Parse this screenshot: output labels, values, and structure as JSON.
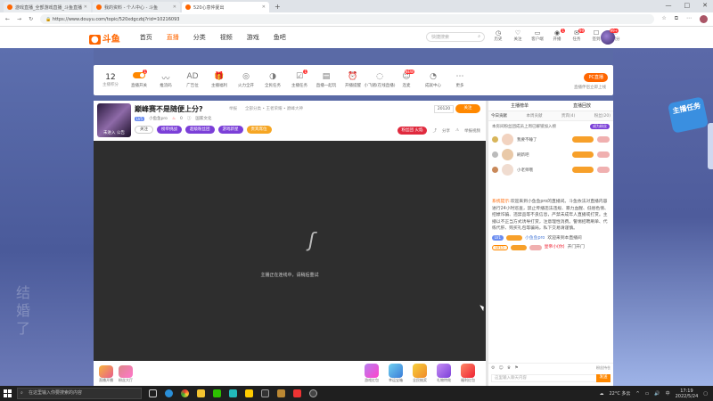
{
  "browser": {
    "tabs": [
      {
        "title": "游戏直播_全部游戏直播_斗鱼直播",
        "active": false
      },
      {
        "title": "我的资料 - 个人中心 - 斗鱼",
        "active": false
      },
      {
        "title": "520心意仲夏出",
        "active": true
      }
    ],
    "new_tab": "+",
    "window_controls": [
      "—",
      "□",
      "✕"
    ],
    "url": "https://www.douyu.com/topic/520xdgczbj?rid=10216093"
  },
  "site": {
    "logo_text": "斗鱼",
    "nav": [
      "首页",
      "直播",
      "分类",
      "视频",
      "游戏",
      "鱼吧"
    ],
    "active_nav": "直播",
    "search_placeholder": "快捷搜索",
    "header_icons": [
      {
        "label": "历史",
        "glyph": "◷",
        "badge": ""
      },
      {
        "label": "关注",
        "glyph": "♡",
        "badge": ""
      },
      {
        "label": "客户端",
        "glyph": "▭",
        "badge": ""
      },
      {
        "label": "开播",
        "glyph": "◉",
        "badge": "1"
      },
      {
        "label": "任务",
        "glyph": "✉",
        "badge": "99"
      },
      {
        "label": "签到",
        "glyph": "☐",
        "badge": ""
      },
      {
        "label": "积分",
        "glyph": "♡",
        "badge": ""
      }
    ],
    "user_badge": "99+"
  },
  "toolbar": {
    "stat_value": "12",
    "stat_label": "主播积分",
    "items": [
      {
        "label": "直播开关",
        "glyph": "⏻",
        "badge": "1"
      },
      {
        "label": "推流码",
        "glyph": "〰",
        "badge": ""
      },
      {
        "label": "广告位",
        "glyph": "AD",
        "badge": ""
      },
      {
        "label": "主播福利",
        "glyph": "🎁",
        "badge": ""
      },
      {
        "label": "火力全开",
        "glyph": "◎",
        "badge": ""
      },
      {
        "label": "全民任务",
        "glyph": "◑",
        "badge": ""
      },
      {
        "label": "主播任务",
        "glyph": "☑",
        "badge": "1"
      },
      {
        "label": "直播一起玩",
        "glyph": "▤",
        "badge": ""
      },
      {
        "label": "开播提醒",
        "glyph": "⏰",
        "badge": ""
      },
      {
        "label": "小飞猪(在线直播)",
        "glyph": "◌",
        "badge": ""
      },
      {
        "label": "连麦",
        "glyph": "☺",
        "badge": "NEW"
      },
      {
        "label": "成就中心",
        "glyph": "◔",
        "badge": ""
      },
      {
        "label": "更多",
        "glyph": "⋯",
        "badge": ""
      }
    ],
    "pc_button": "PC直播",
    "pc_sub": "直播伴侣立即上线"
  },
  "room": {
    "title": "巅峰赛不是随便上分?",
    "report": "举报",
    "category": "全部分类 • 王者荣耀 • 巅峰大神",
    "avatar_caption": "未进入 公告",
    "level": "LV5",
    "anchor_name": "小鱼鱼pro",
    "hot": "0",
    "extra": "国家文化",
    "rank_label": "20120",
    "follow_label": "关注",
    "tags": [
      "关注",
      "榜单挑战",
      "超级粉丝团",
      "游戏新星",
      "贵宾席位"
    ],
    "fan_badge": "粉丝团 火焰",
    "share": "分享",
    "report_video": "举报视频",
    "video_message": "主播正在连线中，请稍后重试"
  },
  "gifts_left": [
    {
      "label": "直播开播"
    },
    {
      "label": "粉丝大厅"
    }
  ],
  "gifts_right": [
    {
      "label": "游戏红包"
    },
    {
      "label": "幸运宝箱"
    },
    {
      "label": "全民抽奖"
    },
    {
      "label": "礼物特效"
    },
    {
      "label": "福利红包"
    }
  ],
  "chatpanel": {
    "tabs": [
      "主播榜单",
      "直播回放"
    ],
    "subtabs": [
      "今日贡献",
      "本周贡献",
      "贵宾(4)",
      "粉丝(20)"
    ],
    "notice": "本房间粉丝团成员上周已解锁加入榜",
    "join_button": "成为粉丝",
    "guards": [
      {
        "name": "我要不睡了"
      },
      {
        "name": "刷新吧"
      },
      {
        "name": "小老师哦"
      }
    ],
    "system_label": "系统提示:",
    "system_text": "欢迎来到小鱼鱼pro的直播间。斗鱼依法对直播内容进行24小时巡查，禁止传播违法违规、暴力血腥、低俗色情、招嫖诈骗、违禁品等不良信息，严禁未成年人直播或打赏。主播以不正当方式诱导打赏，注意理性消费。警惕招聘刷单、代练代肝、购买礼包等骗局，私下交易请谨慎。",
    "msg1_level": "LV1",
    "msg1_user": "小鱼鱼pro",
    "msg1_text": "欢迎来到本直播间",
    "msg2_level": "LV15",
    "msg2_user": "皇帝小(你)",
    "msg2_text": "开门开门",
    "bottom_right": "粉丝持仓",
    "input_placeholder": "这里输入聊天内容",
    "send_label": "发送"
  },
  "mission_banner": "主播任务",
  "watermark": "结婚了",
  "taskbar": {
    "search_placeholder": "在这里输入你要搜索的内容",
    "weather": "22°C 多云",
    "time": "17:19",
    "date": "2022/5/24",
    "ime": "中"
  },
  "colors": {
    "accent": "#ff6600",
    "purple": "#7b3fd8",
    "desktop": "#5a6aa6"
  }
}
